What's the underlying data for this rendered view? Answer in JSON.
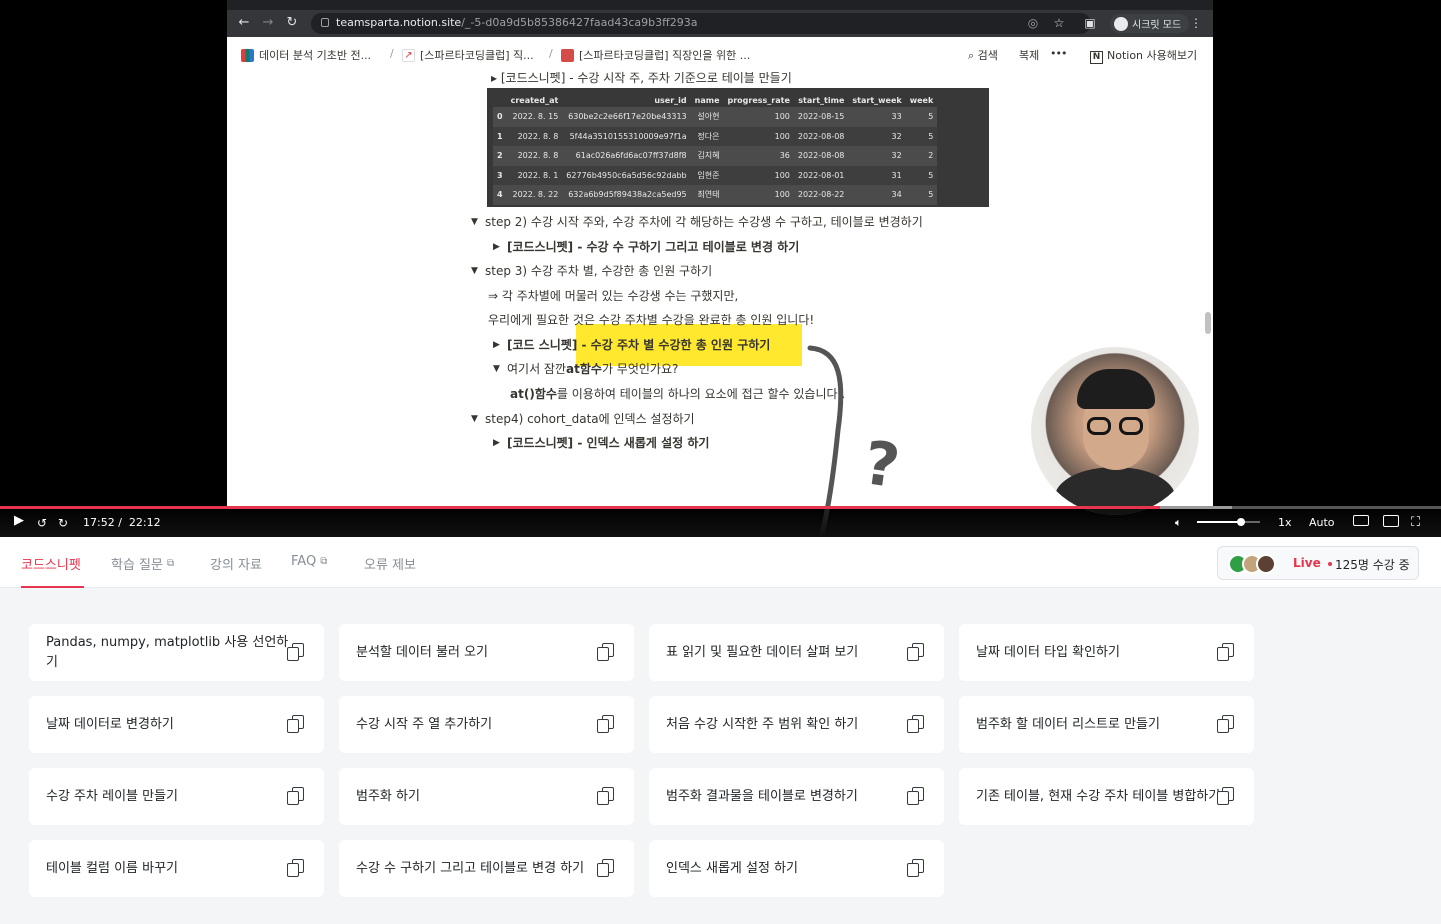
{
  "browser": {
    "url_host": "teamsparta.notion.site",
    "url_path": "/_-5-d0a9d5b85386427faad43ca9b3ff293a",
    "incognito_label": "시크릿 모드"
  },
  "notion": {
    "breadcrumbs": [
      "데이터 분석 기초반 전...",
      "[스파르타코딩클럽] 직...",
      "[스파르타코딩클럽] 직장인을 위한 ..."
    ],
    "search_label": "검색",
    "duplicate_label": "복제",
    "more_label": "•••",
    "try_notion_label": "Notion 사용해보기",
    "cut_line": "[코드스니펫] - 수강 시작 주, 주차 기준으로 테이블 만들기",
    "dataframe": {
      "columns": [
        "",
        "created_at",
        "user_id",
        "name",
        "progress_rate",
        "start_time",
        "start_week",
        "week"
      ],
      "rows": [
        [
          "0",
          "2022. 8. 15",
          "630be2c2e66f17e20be43313",
          "설아현",
          "100",
          "2022-08-15",
          "33",
          "5"
        ],
        [
          "1",
          "2022. 8. 8",
          "5f44a3510155310009e97f1a",
          "정다은",
          "100",
          "2022-08-08",
          "32",
          "5"
        ],
        [
          "2",
          "2022. 8. 8",
          "61ac026a6fd6ac07ff37d8f8",
          "김지혜",
          "36",
          "2022-08-08",
          "32",
          "2"
        ],
        [
          "3",
          "2022. 8. 1",
          "62776b4950c6a5d56c92dabb",
          "임현준",
          "100",
          "2022-08-01",
          "31",
          "5"
        ],
        [
          "4",
          "2022. 8. 22",
          "632a6b9d5f89438a2ca5ed95",
          "최연태",
          "100",
          "2022-08-22",
          "34",
          "5"
        ]
      ]
    },
    "lines": {
      "step2": "step 2) 수강 시작 주와, 수강 주차에 각 해당하는 수강생 수 구하고, 테이블로 변경하기",
      "step2_snippet": "[코드스니펫] - 수강 수 구하기 그리고 테이블로 변경 하기",
      "step3": "step 3) 수강 주차 별, 수강한 총 인원 구하기",
      "step3_note1": "⇒ 각 주차별에 머물러 있는 수강생 수는 구했지만,",
      "step3_note2": "우리에게 필요한 것은 수강 주차별 수강을 완료한 총 인원 입니다!",
      "step3_snippet": "[코드 스니펫] - 수강 주차 별 수강한 총 인원 구하기",
      "at_question_pre": "여기서 잠깐 ",
      "at_question_at": "at",
      "at_question_func": " 함수",
      "at_question_post": "가 무엇인가요?",
      "at_desc_code": "at()",
      "at_desc_func": " 함수",
      "at_desc_post": "를 이용하여 테이블의 하나의 요소에 접근 할수 있습니다 .",
      "step4": "step4) cohort_data에 인덱스 설정하기",
      "step4_snippet": "[코드스니펫] - 인덱스 새롭게 설정 하기"
    }
  },
  "player": {
    "current_time": "17:52 /",
    "duration": "22:12",
    "progress": 0.805,
    "buffered": 0.855,
    "volume": 0.7,
    "speed": "1x",
    "quality": "Auto",
    "annotation_mark": "?",
    "accent_color": "#e8344e"
  },
  "tabs": {
    "items": [
      {
        "label": "코드스니펫",
        "active": true,
        "external": false
      },
      {
        "label": "학습 질문",
        "active": false,
        "external": true
      },
      {
        "label": "강의 자료",
        "active": false,
        "external": false
      },
      {
        "label": "FAQ",
        "active": false,
        "external": true
      },
      {
        "label": "오류 제보",
        "active": false,
        "external": false
      }
    ],
    "live": {
      "label": "Live",
      "count": "125명 수강 중"
    }
  },
  "snippets": [
    "Pandas, numpy, matplotlib 사용 선언하기",
    "분석할 데이터 불러 오기",
    "표 읽기 및 필요한 데이터 살펴 보기",
    "날짜 데이터 타입 확인하기",
    "날짜 데이터로 변경하기",
    "수강 시작 주 열 추가하기",
    "처음 수강 시작한 주 범위 확인 하기",
    "범주화 할 데이터 리스트로 만들기",
    "수강 주차 레이블 만들기",
    "범주화 하기",
    "범주화 결과물을 테이블로 변경하기",
    "기존 테이블, 현재 수강 주차 테이블 병합하기",
    "테이블 컬럼 이름 바꾸기",
    "수강 수 구하기 그리고 테이블로 변경 하기",
    "인덱스 새롭게 설정 하기"
  ]
}
